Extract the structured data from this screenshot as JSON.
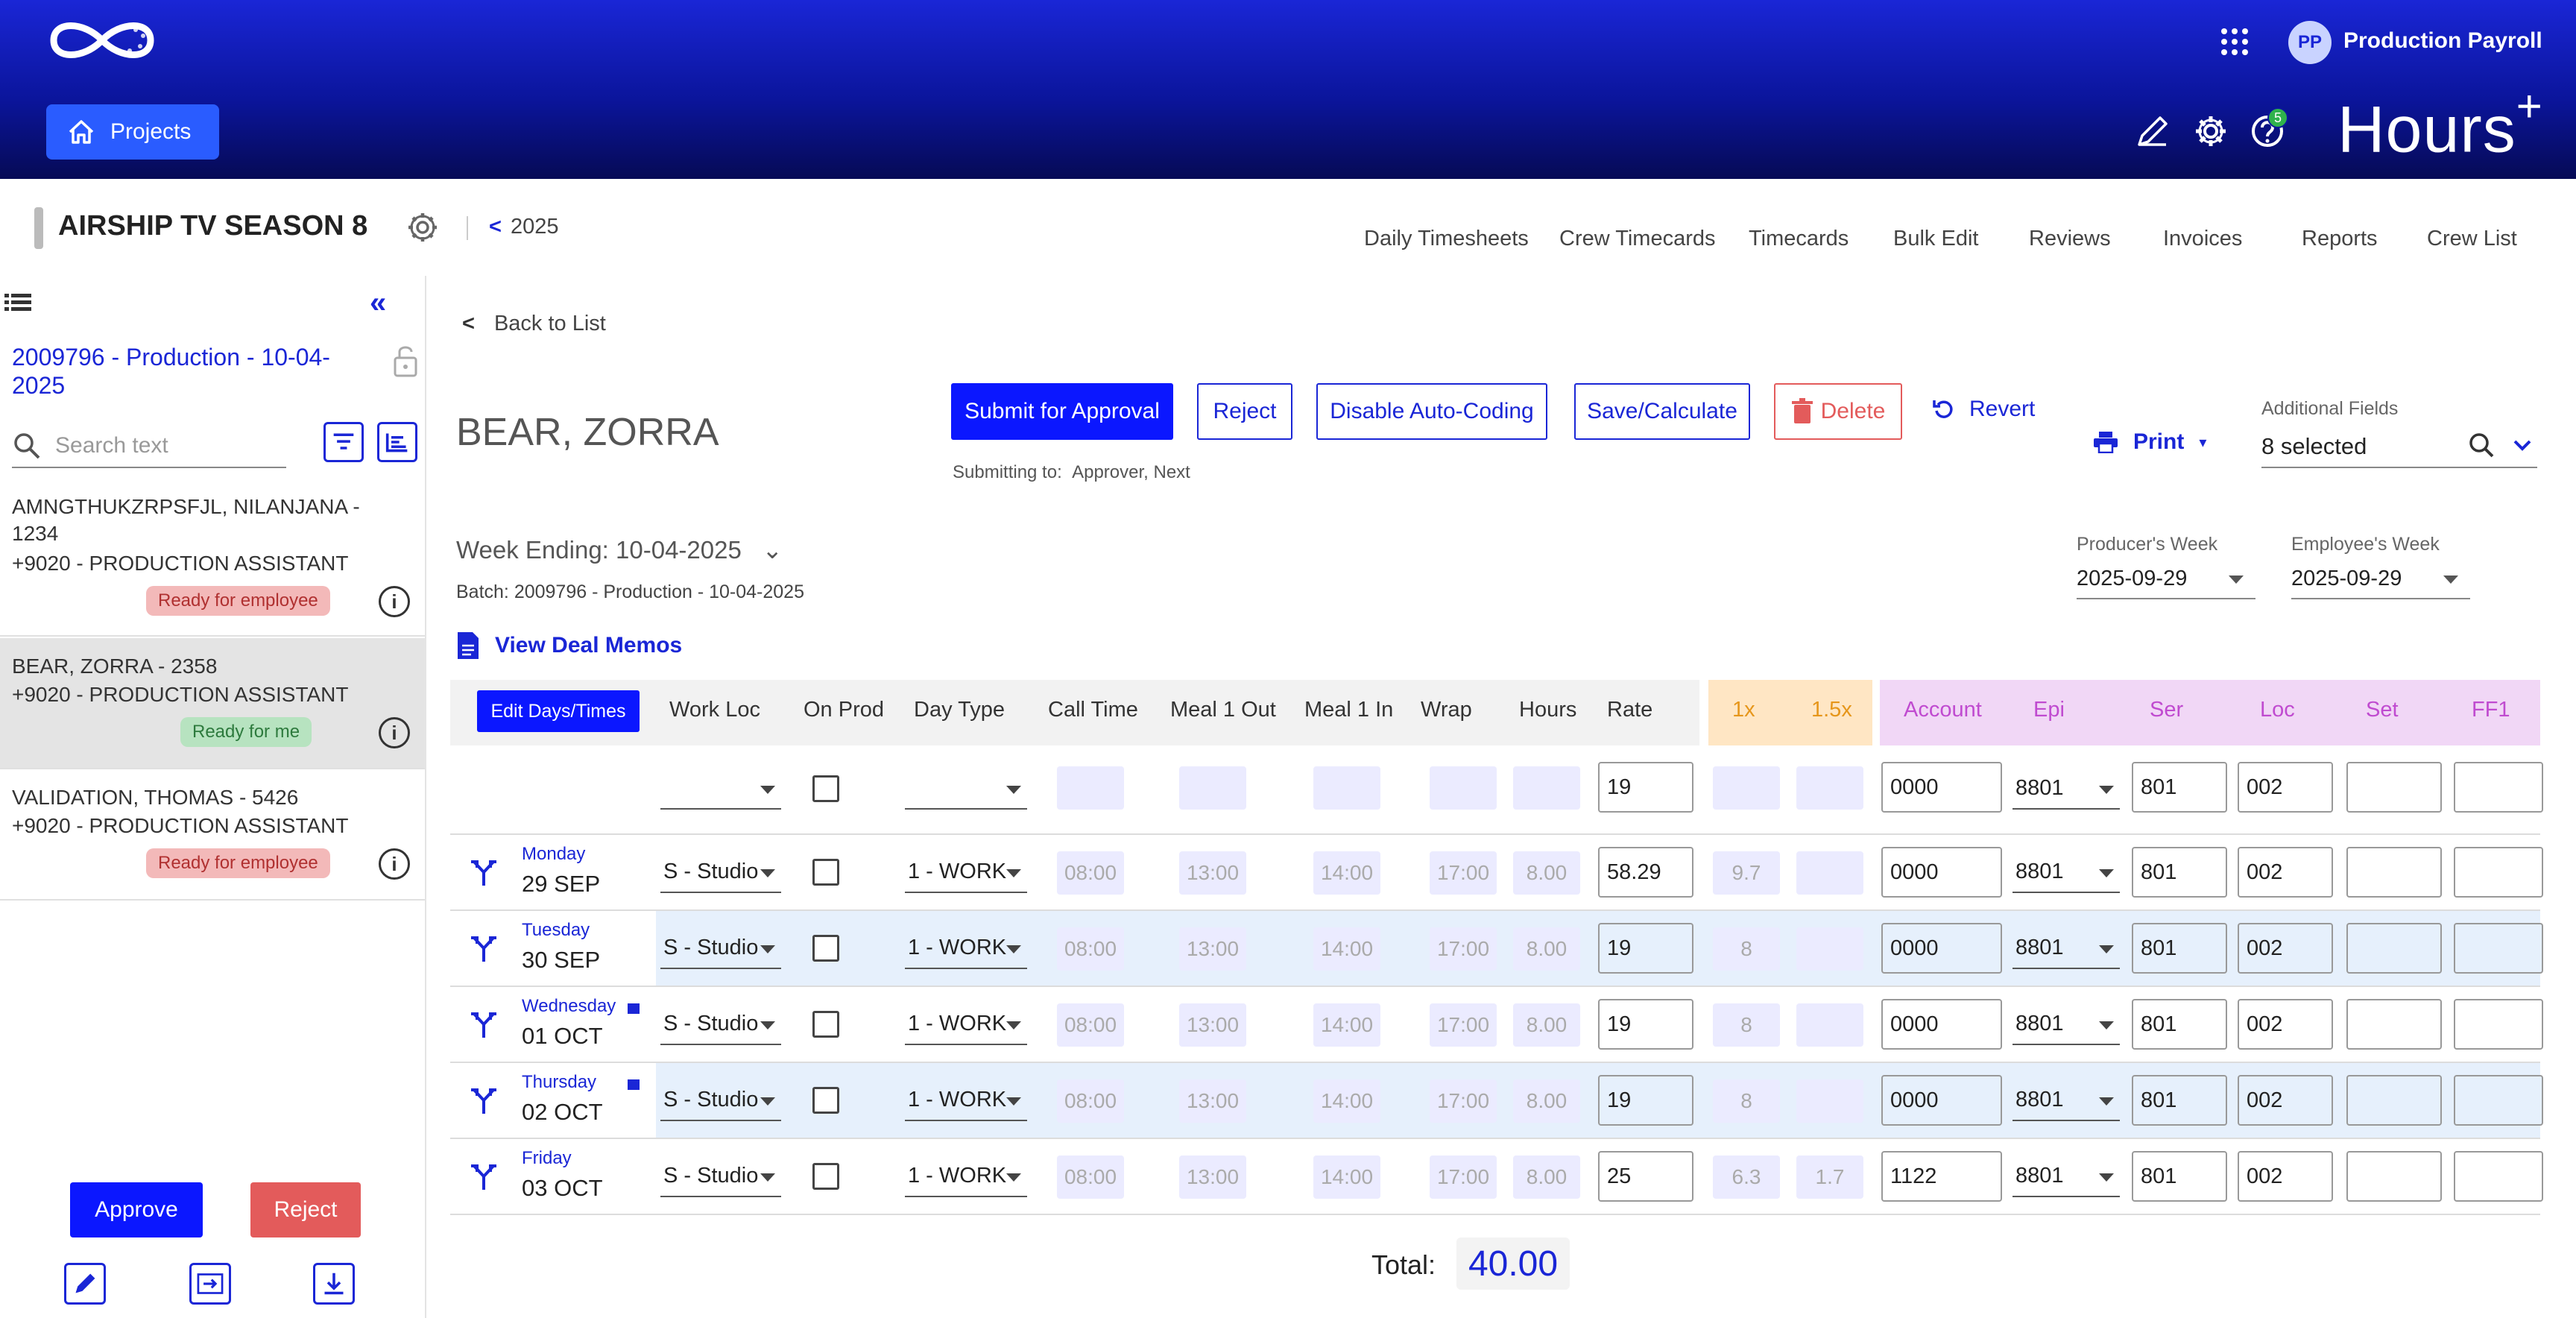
{
  "header": {
    "projects_label": "Projects",
    "user_initials": "PP",
    "user_name": "Production Payroll",
    "notifications_count": "5",
    "brand": "Hours",
    "brand_sup": "+"
  },
  "project": {
    "title": "AIRSHIP TV SEASON 8",
    "year": "2025",
    "nav": [
      "Daily Timesheets",
      "Crew Timecards",
      "Timecards",
      "Bulk Edit",
      "Reviews",
      "Invoices",
      "Reports",
      "Crew List"
    ]
  },
  "sidebar": {
    "batch": "2009796 - Production - 10-04-2025",
    "search_placeholder": "Search text",
    "employees": [
      {
        "name": "AMNGTHUKZRPSFJL, NILANJANA - 1234",
        "role": "+9020 - PRODUCTION ASSISTANT",
        "status": "Ready for employee",
        "status_color": "#f3b9b9"
      },
      {
        "name": "BEAR, ZORRA - 2358",
        "role": "+9020 - PRODUCTION ASSISTANT",
        "status": "Ready for me",
        "status_color": "#b7e3c0"
      },
      {
        "name": "VALIDATION, THOMAS - 5426",
        "role": "+9020 - PRODUCTION ASSISTANT",
        "status": "Ready for employee",
        "status_color": "#f3b9b9"
      }
    ],
    "approve_label": "Approve",
    "reject_label": "Reject"
  },
  "timecard": {
    "back_label": "Back to List",
    "employee": "BEAR, ZORRA",
    "buttons": {
      "submit": "Submit for Approval",
      "reject": "Reject",
      "disable_auto": "Disable Auto-Coding",
      "save": "Save/Calculate",
      "delete": "Delete",
      "revert": "Revert",
      "print": "Print"
    },
    "submitting_label": "Submitting to:",
    "submitting_to": "Approver, Next",
    "additional_fields_label": "Additional Fields",
    "additional_fields_value": "8 selected",
    "week_ending": "Week Ending: 10-04-2025",
    "batch": "Batch: 2009796 - Production - 10-04-2025",
    "view_deal_memos": "View Deal Memos",
    "producers_week_label": "Producer's Week",
    "producers_week": "2025-09-29",
    "employees_week_label": "Employee's Week",
    "employees_week": "2025-09-29"
  },
  "grid": {
    "edit_days_label": "Edit Days/Times",
    "columns": [
      "Work Loc",
      "On Prod",
      "Day Type",
      "Call Time",
      "Meal 1 Out",
      "Meal 1 In",
      "Wrap",
      "Hours",
      "Rate"
    ],
    "ot_columns": [
      "1x",
      "1.5x"
    ],
    "acct_columns": [
      "Account",
      "Epi",
      "Ser",
      "Loc",
      "Set",
      "FF1"
    ],
    "default_row": {
      "rate": "19",
      "account": "0000",
      "epi": "8801",
      "ser": "801",
      "loc": "002"
    },
    "rows": [
      {
        "day": "Monday",
        "date": "29 SEP",
        "work_loc": "S - Studio",
        "day_type": "1 - WORK",
        "call": "08:00",
        "meal_out": "13:00",
        "meal_in": "14:00",
        "wrap": "17:00",
        "hours": "8.00",
        "rate": "58.29",
        "x1": "9.7",
        "x15": "",
        "account": "0000",
        "epi": "8801",
        "ser": "801",
        "loc": "002"
      },
      {
        "day": "Tuesday",
        "date": "30 SEP",
        "work_loc": "S - Studio",
        "day_type": "1 - WORK",
        "call": "08:00",
        "meal_out": "13:00",
        "meal_in": "14:00",
        "wrap": "17:00",
        "hours": "8.00",
        "rate": "19",
        "x1": "8",
        "x15": "",
        "account": "0000",
        "epi": "8801",
        "ser": "801",
        "loc": "002"
      },
      {
        "day": "Wednesday",
        "date": "01 OCT",
        "work_loc": "S - Studio",
        "day_type": "1 - WORK",
        "call": "08:00",
        "meal_out": "13:00",
        "meal_in": "14:00",
        "wrap": "17:00",
        "hours": "8.00",
        "rate": "19",
        "x1": "8",
        "x15": "",
        "account": "0000",
        "epi": "8801",
        "ser": "801",
        "loc": "002"
      },
      {
        "day": "Thursday",
        "date": "02 OCT",
        "work_loc": "S - Studio",
        "day_type": "1 - WORK",
        "call": "08:00",
        "meal_out": "13:00",
        "meal_in": "14:00",
        "wrap": "17:00",
        "hours": "8.00",
        "rate": "19",
        "x1": "8",
        "x15": "",
        "account": "0000",
        "epi": "8801",
        "ser": "801",
        "loc": "002"
      },
      {
        "day": "Friday",
        "date": "03 OCT",
        "work_loc": "S - Studio",
        "day_type": "1 - WORK",
        "call": "08:00",
        "meal_out": "13:00",
        "meal_in": "14:00",
        "wrap": "17:00",
        "hours": "8.00",
        "rate": "25",
        "x1": "6.3",
        "x15": "1.7",
        "account": "1122",
        "epi": "8801",
        "ser": "801",
        "loc": "002"
      }
    ],
    "total_label": "Total:",
    "total_value": "40.00"
  },
  "colors": {
    "accent": "#1a26d6",
    "primary_button": "#0b17ff",
    "danger": "#e35b5b",
    "row_band": "#e6f0fc"
  }
}
